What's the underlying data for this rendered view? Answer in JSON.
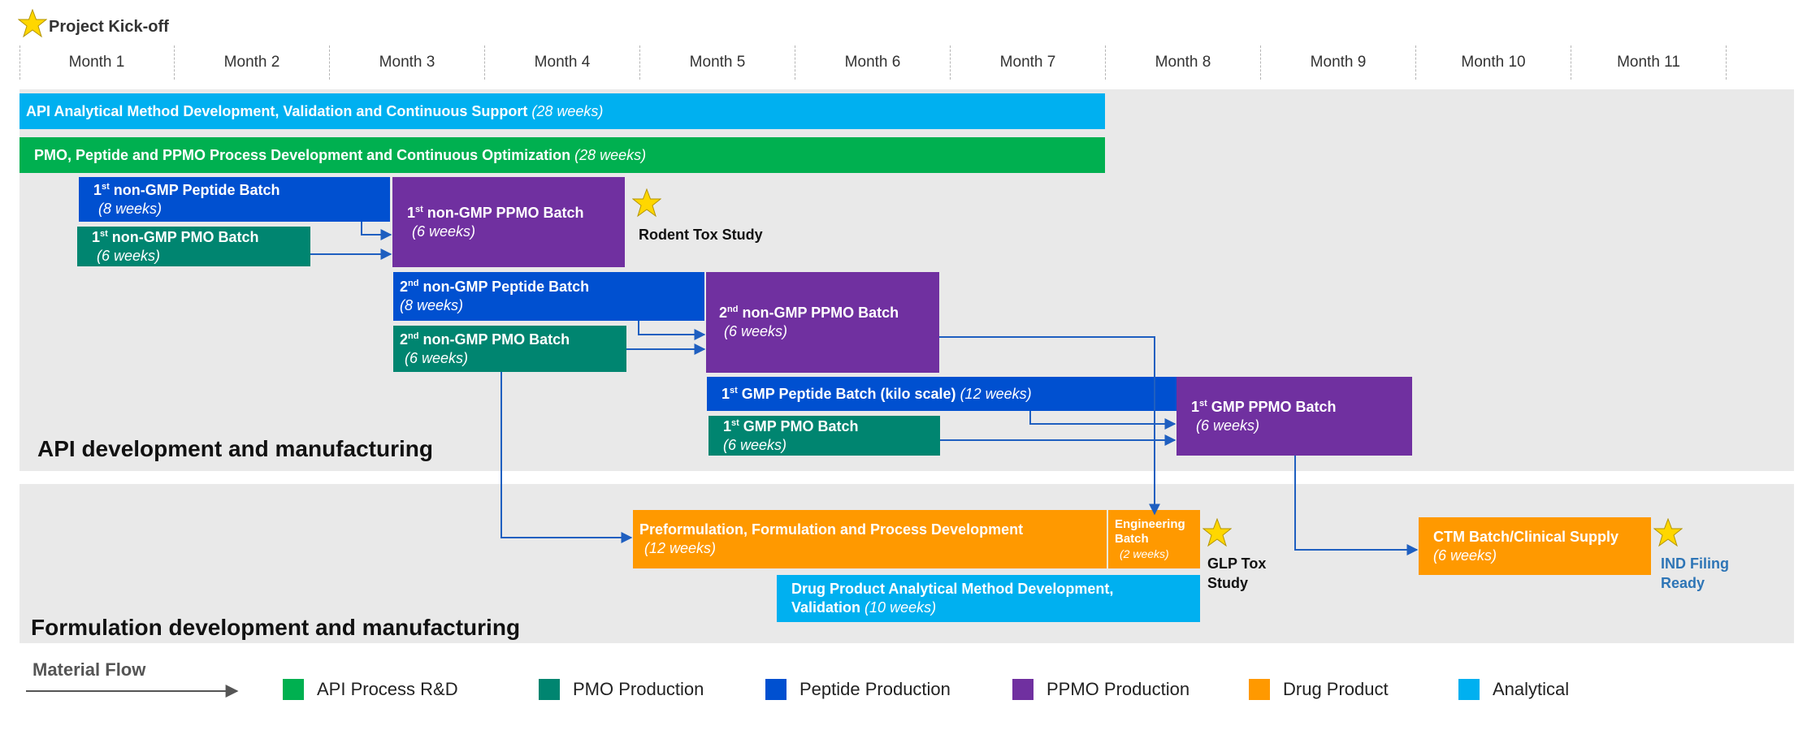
{
  "header": {
    "kickoff_label": "Project Kick-off",
    "kickoff_icon": "star-icon"
  },
  "timeline": {
    "months": [
      "Month 1",
      "Month 2",
      "Month 3",
      "Month 4",
      "Month 5",
      "Month 6",
      "Month 7",
      "Month 8",
      "Month 9",
      "Month 10",
      "Month 11"
    ]
  },
  "sections": {
    "api": "API development and manufacturing",
    "formulation": "Formulation development and manufacturing"
  },
  "bars": {
    "api_analytical": {
      "title": "API Analytical Method Development, Validation and Continuous Support",
      "duration": "(28 weeks)"
    },
    "process_dev": {
      "title": "PMO, Peptide and PPMO Process Development and Continuous Optimization",
      "duration": "(28 weeks)"
    },
    "pep1": {
      "ord": "1",
      "sup": "st",
      "title": " non-GMP Peptide Batch",
      "duration": "(8 weeks)"
    },
    "pmo1": {
      "ord": "1",
      "sup": "st",
      "title": " non-GMP PMO Batch",
      "duration": "(6 weeks)"
    },
    "ppmo1": {
      "ord": "1",
      "sup": "st",
      "title": " non-GMP PPMO Batch",
      "duration": "(6 weeks)"
    },
    "pep2": {
      "ord": "2",
      "sup": "nd",
      "title": " non-GMP Peptide Batch",
      "duration": "(8 weeks)"
    },
    "pmo2": {
      "ord": "2",
      "sup": "nd",
      "title": " non-GMP PMO  Batch",
      "duration": "(6 weeks)"
    },
    "ppmo2": {
      "ord": "2",
      "sup": "nd",
      "title": " non-GMP PPMO Batch",
      "duration": "(6 weeks)"
    },
    "gmp_pep": {
      "ord": "1",
      "sup": "st",
      "title": " GMP Peptide Batch (kilo scale)",
      "duration": "(12 weeks)"
    },
    "gmp_pmo": {
      "ord": "1",
      "sup": "st",
      "title": " GMP PMO Batch",
      "duration": "(6 weeks)"
    },
    "gmp_ppmo": {
      "ord": "1",
      "sup": "st",
      "title": " GMP PPMO Batch",
      "duration": "(6 weeks)"
    },
    "preform": {
      "title": "Preformulation, Formulation and Process Development",
      "duration": "(12 weeks)"
    },
    "eng": {
      "title": "Engineering Batch",
      "duration": "(2 weeks)"
    },
    "dp_analytical": {
      "title1": "Drug Product Analytical Method Development,",
      "title2": "Validation",
      "duration": "(10 weeks)"
    },
    "ctm": {
      "title": "CTM Batch/Clinical Supply",
      "duration": "(6 weeks)"
    }
  },
  "milestones": {
    "rodent": "Rodent Tox Study",
    "glp1": "GLP Tox",
    "glp2": "Study",
    "ind1": "IND Filing",
    "ind2": "Ready"
  },
  "legend": {
    "flow_label": "Material Flow",
    "items": [
      {
        "label": "API Process R&D",
        "color": "#00b050"
      },
      {
        "label": "PMO Production",
        "color": "#008570"
      },
      {
        "label": "Peptide Production",
        "color": "#0050d0"
      },
      {
        "label": "PPMO Production",
        "color": "#7030a0"
      },
      {
        "label": "Drug Product",
        "color": "#ff9900"
      },
      {
        "label": "Analytical",
        "color": "#00b0f0"
      }
    ]
  },
  "colors": {
    "arrow": "#1f5fc0",
    "band": "#e9e9e9",
    "star": "#ffd700"
  }
}
